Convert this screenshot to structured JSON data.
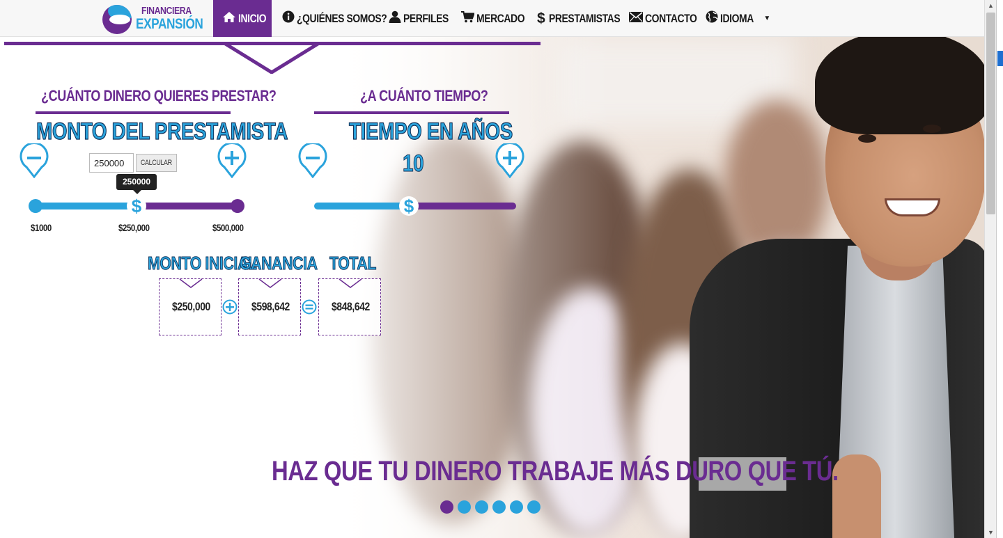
{
  "brand": {
    "top": "FINANCIERA",
    "bottom": "EXPANSIÓN"
  },
  "nav": {
    "inicio": "INICIO",
    "quienes": "¿QUIÉNES SOMOS?",
    "perfiles": "PERFILES",
    "mercado": "MERCADO",
    "prestamistas": "PRESTAMISTAS",
    "contacto": "CONTACTO",
    "idioma": "IDIOMA",
    "prestamistas_icon": "$"
  },
  "calculator": {
    "amount_question": "¿CUÁNTO DINERO QUIERES PRESTAR?",
    "amount_title": "MONTO DEL PRESTAMISTA",
    "amount_input_value": "250000",
    "calc_button": "CALCULAR",
    "tooltip": "250000",
    "amount_fraction": 0.5,
    "tick_min": "$1000",
    "tick_mid": "$250,000",
    "tick_max": "$500,000",
    "time_question": "¿A CUÁNTO TIEMPO?",
    "time_title": "TIEMPO EN AÑOS",
    "years_value": "10",
    "years_fraction": 0.47,
    "handle_symbol": "$"
  },
  "results": {
    "initial_label": "MONTO INICIAL",
    "initial_value": "$250,000",
    "gain_label": "GANANCIA",
    "gain_value": "$598,642",
    "total_label": "TOTAL",
    "total_value": "$848,642"
  },
  "hero": {
    "slogan": "HAZ QUE TU DINERO TRABAJE MÁS DURO QUE TÚ.",
    "carousel_count": 6,
    "carousel_active": 0
  },
  "colors": {
    "purple": "#6a2c91",
    "blue": "#2aa3dc",
    "dark_navy": "#0e2f57"
  },
  "icons": [
    "home-icon",
    "info-icon",
    "user-icon",
    "cart-icon",
    "dollar-icon",
    "envelope-icon",
    "globe-icon",
    "minus-pin-icon",
    "plus-pin-icon"
  ]
}
